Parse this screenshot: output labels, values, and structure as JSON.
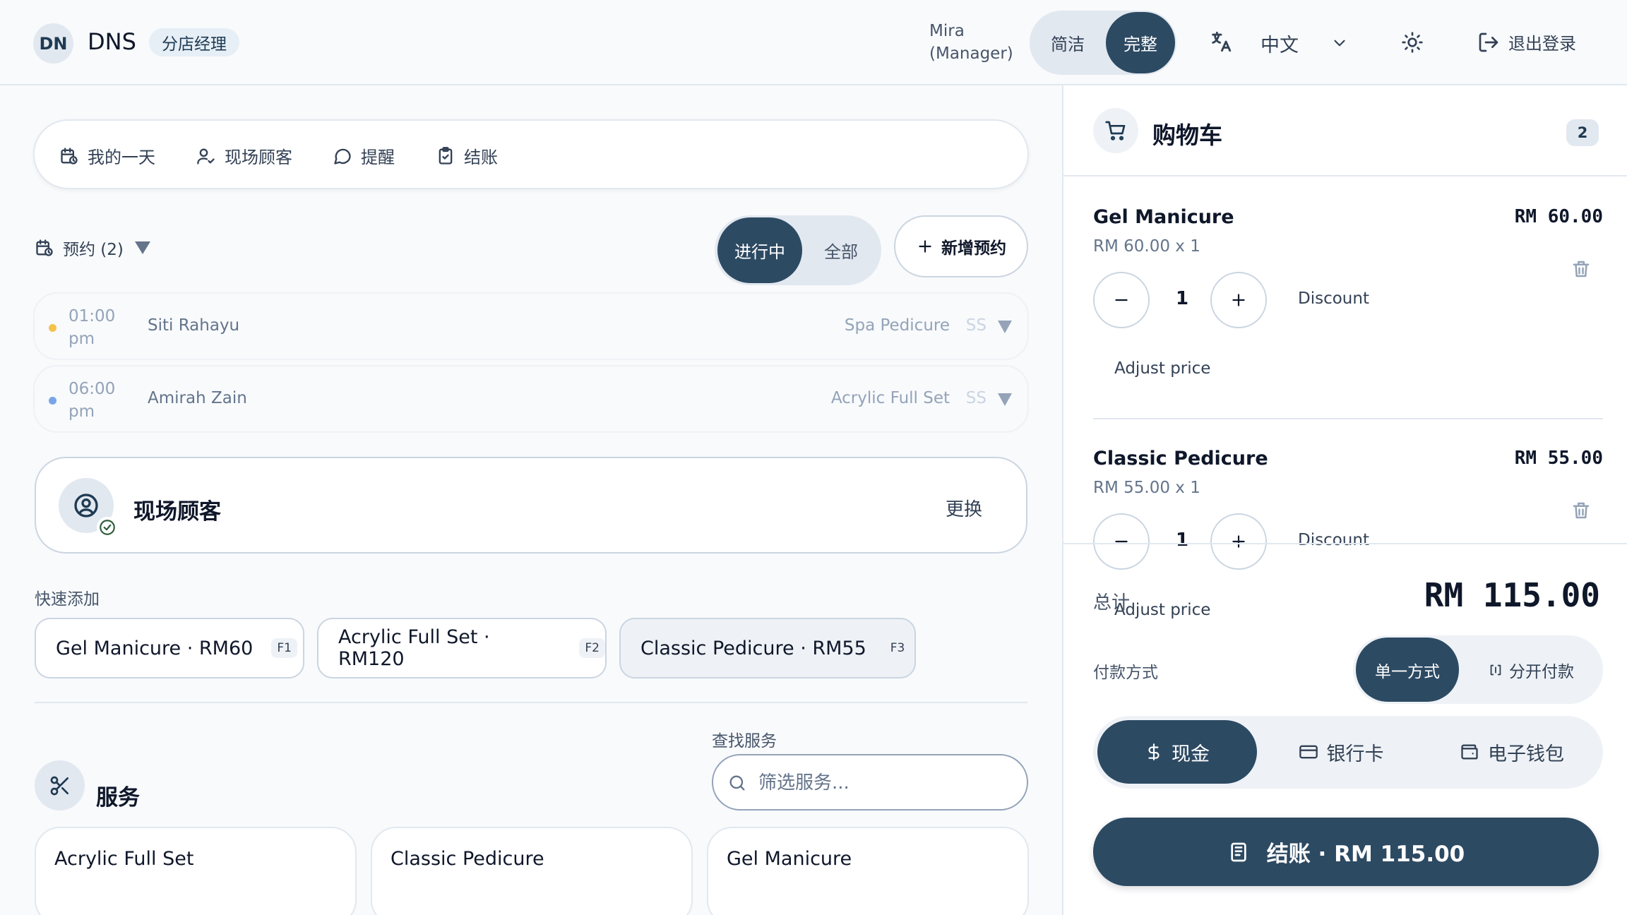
{
  "header": {
    "logo_initials": "DN",
    "brand": "DNS",
    "role": "分店经理",
    "user_name": "Mira",
    "user_role": "(Manager)",
    "mode_simple": "简洁",
    "mode_full": "完整",
    "language": "中文",
    "logout": "退出登录"
  },
  "nav": {
    "my_day": "我的一天",
    "walk_in": "现场顾客",
    "reminders": "提醒",
    "checkout": "结账"
  },
  "appointments": {
    "title": "预约 (2)",
    "filter_active": "进行中",
    "filter_all": "全部",
    "add_label": "新增预约",
    "rows": [
      {
        "time": "01:00",
        "period": "pm",
        "customer": "Siti Rahayu",
        "service": "Spa Pedicure",
        "staff": "SS",
        "dot_color": "#f5c14b"
      },
      {
        "time": "06:00",
        "period": "pm",
        "customer": "Amirah Zain",
        "service": "Acrylic Full Set",
        "staff": "SS",
        "dot_color": "#7aa5e8"
      }
    ]
  },
  "walk_in_card": {
    "title": "现场顾客",
    "change": "更换"
  },
  "quick_add": {
    "label": "快速添加",
    "chips": [
      {
        "label": "Gel Manicure · RM60",
        "key": "F1"
      },
      {
        "label": "Acrylic Full Set · RM120",
        "key": "F2"
      },
      {
        "label": "Classic Pedicure · RM55",
        "key": "F3"
      }
    ]
  },
  "services": {
    "title": "服务",
    "search_label": "查找服务",
    "search_placeholder": "筛选服务...",
    "cards": [
      {
        "name": "Acrylic Full Set"
      },
      {
        "name": "Classic Pedicure"
      },
      {
        "name": "Gel Manicure"
      }
    ]
  },
  "cart": {
    "title": "购物车",
    "count": "2",
    "items": [
      {
        "name": "Gel Manicure",
        "unit": "RM 60.00 x 1",
        "price": "RM 60.00",
        "qty": "1",
        "discount": "Discount",
        "adjust": "Adjust price"
      },
      {
        "name": "Classic Pedicure",
        "unit": "RM 55.00 x 1",
        "price": "RM 55.00",
        "qty": "1",
        "discount": "Discount",
        "adjust": "Adjust price"
      }
    ],
    "total_label": "总计",
    "total_value": "RM 115.00",
    "pay_label": "付款方式",
    "pay_single": "单一方式",
    "pay_split": "分开付款",
    "method_cash": "现金",
    "method_card": "银行卡",
    "method_ewallet": "电子钱包",
    "checkout": "结账 · RM 115.00"
  },
  "colors": {
    "primary": "#2d4a63",
    "background": "#f8fafc",
    "border": "#e2e8f0"
  }
}
